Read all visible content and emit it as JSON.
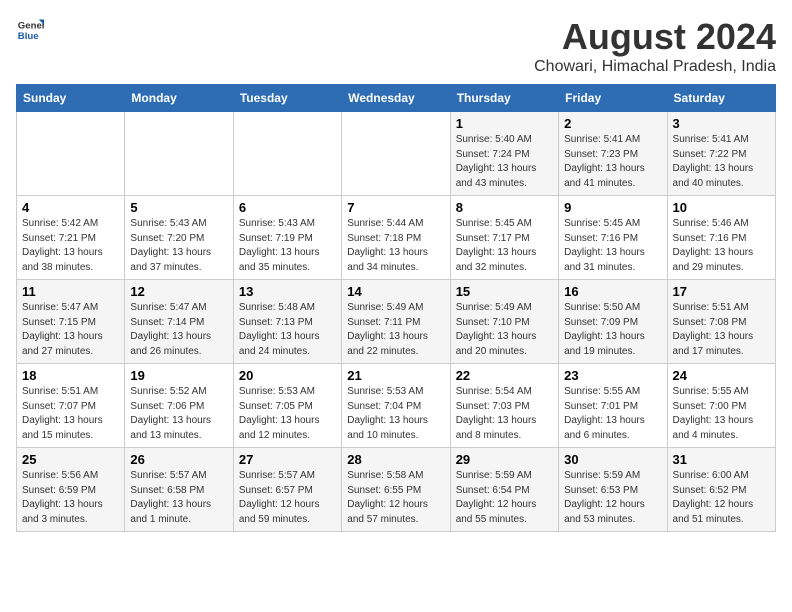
{
  "header": {
    "logo_line1": "General",
    "logo_line2": "Blue",
    "main_title": "August 2024",
    "subtitle": "Chowari, Himachal Pradesh, India"
  },
  "days_of_week": [
    "Sunday",
    "Monday",
    "Tuesday",
    "Wednesday",
    "Thursday",
    "Friday",
    "Saturday"
  ],
  "weeks": [
    [
      {
        "day": "",
        "info": ""
      },
      {
        "day": "",
        "info": ""
      },
      {
        "day": "",
        "info": ""
      },
      {
        "day": "",
        "info": ""
      },
      {
        "day": "1",
        "info": "Sunrise: 5:40 AM\nSunset: 7:24 PM\nDaylight: 13 hours\nand 43 minutes."
      },
      {
        "day": "2",
        "info": "Sunrise: 5:41 AM\nSunset: 7:23 PM\nDaylight: 13 hours\nand 41 minutes."
      },
      {
        "day": "3",
        "info": "Sunrise: 5:41 AM\nSunset: 7:22 PM\nDaylight: 13 hours\nand 40 minutes."
      }
    ],
    [
      {
        "day": "4",
        "info": "Sunrise: 5:42 AM\nSunset: 7:21 PM\nDaylight: 13 hours\nand 38 minutes."
      },
      {
        "day": "5",
        "info": "Sunrise: 5:43 AM\nSunset: 7:20 PM\nDaylight: 13 hours\nand 37 minutes."
      },
      {
        "day": "6",
        "info": "Sunrise: 5:43 AM\nSunset: 7:19 PM\nDaylight: 13 hours\nand 35 minutes."
      },
      {
        "day": "7",
        "info": "Sunrise: 5:44 AM\nSunset: 7:18 PM\nDaylight: 13 hours\nand 34 minutes."
      },
      {
        "day": "8",
        "info": "Sunrise: 5:45 AM\nSunset: 7:17 PM\nDaylight: 13 hours\nand 32 minutes."
      },
      {
        "day": "9",
        "info": "Sunrise: 5:45 AM\nSunset: 7:16 PM\nDaylight: 13 hours\nand 31 minutes."
      },
      {
        "day": "10",
        "info": "Sunrise: 5:46 AM\nSunset: 7:16 PM\nDaylight: 13 hours\nand 29 minutes."
      }
    ],
    [
      {
        "day": "11",
        "info": "Sunrise: 5:47 AM\nSunset: 7:15 PM\nDaylight: 13 hours\nand 27 minutes."
      },
      {
        "day": "12",
        "info": "Sunrise: 5:47 AM\nSunset: 7:14 PM\nDaylight: 13 hours\nand 26 minutes."
      },
      {
        "day": "13",
        "info": "Sunrise: 5:48 AM\nSunset: 7:13 PM\nDaylight: 13 hours\nand 24 minutes."
      },
      {
        "day": "14",
        "info": "Sunrise: 5:49 AM\nSunset: 7:11 PM\nDaylight: 13 hours\nand 22 minutes."
      },
      {
        "day": "15",
        "info": "Sunrise: 5:49 AM\nSunset: 7:10 PM\nDaylight: 13 hours\nand 20 minutes."
      },
      {
        "day": "16",
        "info": "Sunrise: 5:50 AM\nSunset: 7:09 PM\nDaylight: 13 hours\nand 19 minutes."
      },
      {
        "day": "17",
        "info": "Sunrise: 5:51 AM\nSunset: 7:08 PM\nDaylight: 13 hours\nand 17 minutes."
      }
    ],
    [
      {
        "day": "18",
        "info": "Sunrise: 5:51 AM\nSunset: 7:07 PM\nDaylight: 13 hours\nand 15 minutes."
      },
      {
        "day": "19",
        "info": "Sunrise: 5:52 AM\nSunset: 7:06 PM\nDaylight: 13 hours\nand 13 minutes."
      },
      {
        "day": "20",
        "info": "Sunrise: 5:53 AM\nSunset: 7:05 PM\nDaylight: 13 hours\nand 12 minutes."
      },
      {
        "day": "21",
        "info": "Sunrise: 5:53 AM\nSunset: 7:04 PM\nDaylight: 13 hours\nand 10 minutes."
      },
      {
        "day": "22",
        "info": "Sunrise: 5:54 AM\nSunset: 7:03 PM\nDaylight: 13 hours\nand 8 minutes."
      },
      {
        "day": "23",
        "info": "Sunrise: 5:55 AM\nSunset: 7:01 PM\nDaylight: 13 hours\nand 6 minutes."
      },
      {
        "day": "24",
        "info": "Sunrise: 5:55 AM\nSunset: 7:00 PM\nDaylight: 13 hours\nand 4 minutes."
      }
    ],
    [
      {
        "day": "25",
        "info": "Sunrise: 5:56 AM\nSunset: 6:59 PM\nDaylight: 13 hours\nand 3 minutes."
      },
      {
        "day": "26",
        "info": "Sunrise: 5:57 AM\nSunset: 6:58 PM\nDaylight: 13 hours\nand 1 minute."
      },
      {
        "day": "27",
        "info": "Sunrise: 5:57 AM\nSunset: 6:57 PM\nDaylight: 12 hours\nand 59 minutes."
      },
      {
        "day": "28",
        "info": "Sunrise: 5:58 AM\nSunset: 6:55 PM\nDaylight: 12 hours\nand 57 minutes."
      },
      {
        "day": "29",
        "info": "Sunrise: 5:59 AM\nSunset: 6:54 PM\nDaylight: 12 hours\nand 55 minutes."
      },
      {
        "day": "30",
        "info": "Sunrise: 5:59 AM\nSunset: 6:53 PM\nDaylight: 12 hours\nand 53 minutes."
      },
      {
        "day": "31",
        "info": "Sunrise: 6:00 AM\nSunset: 6:52 PM\nDaylight: 12 hours\nand 51 minutes."
      }
    ]
  ]
}
